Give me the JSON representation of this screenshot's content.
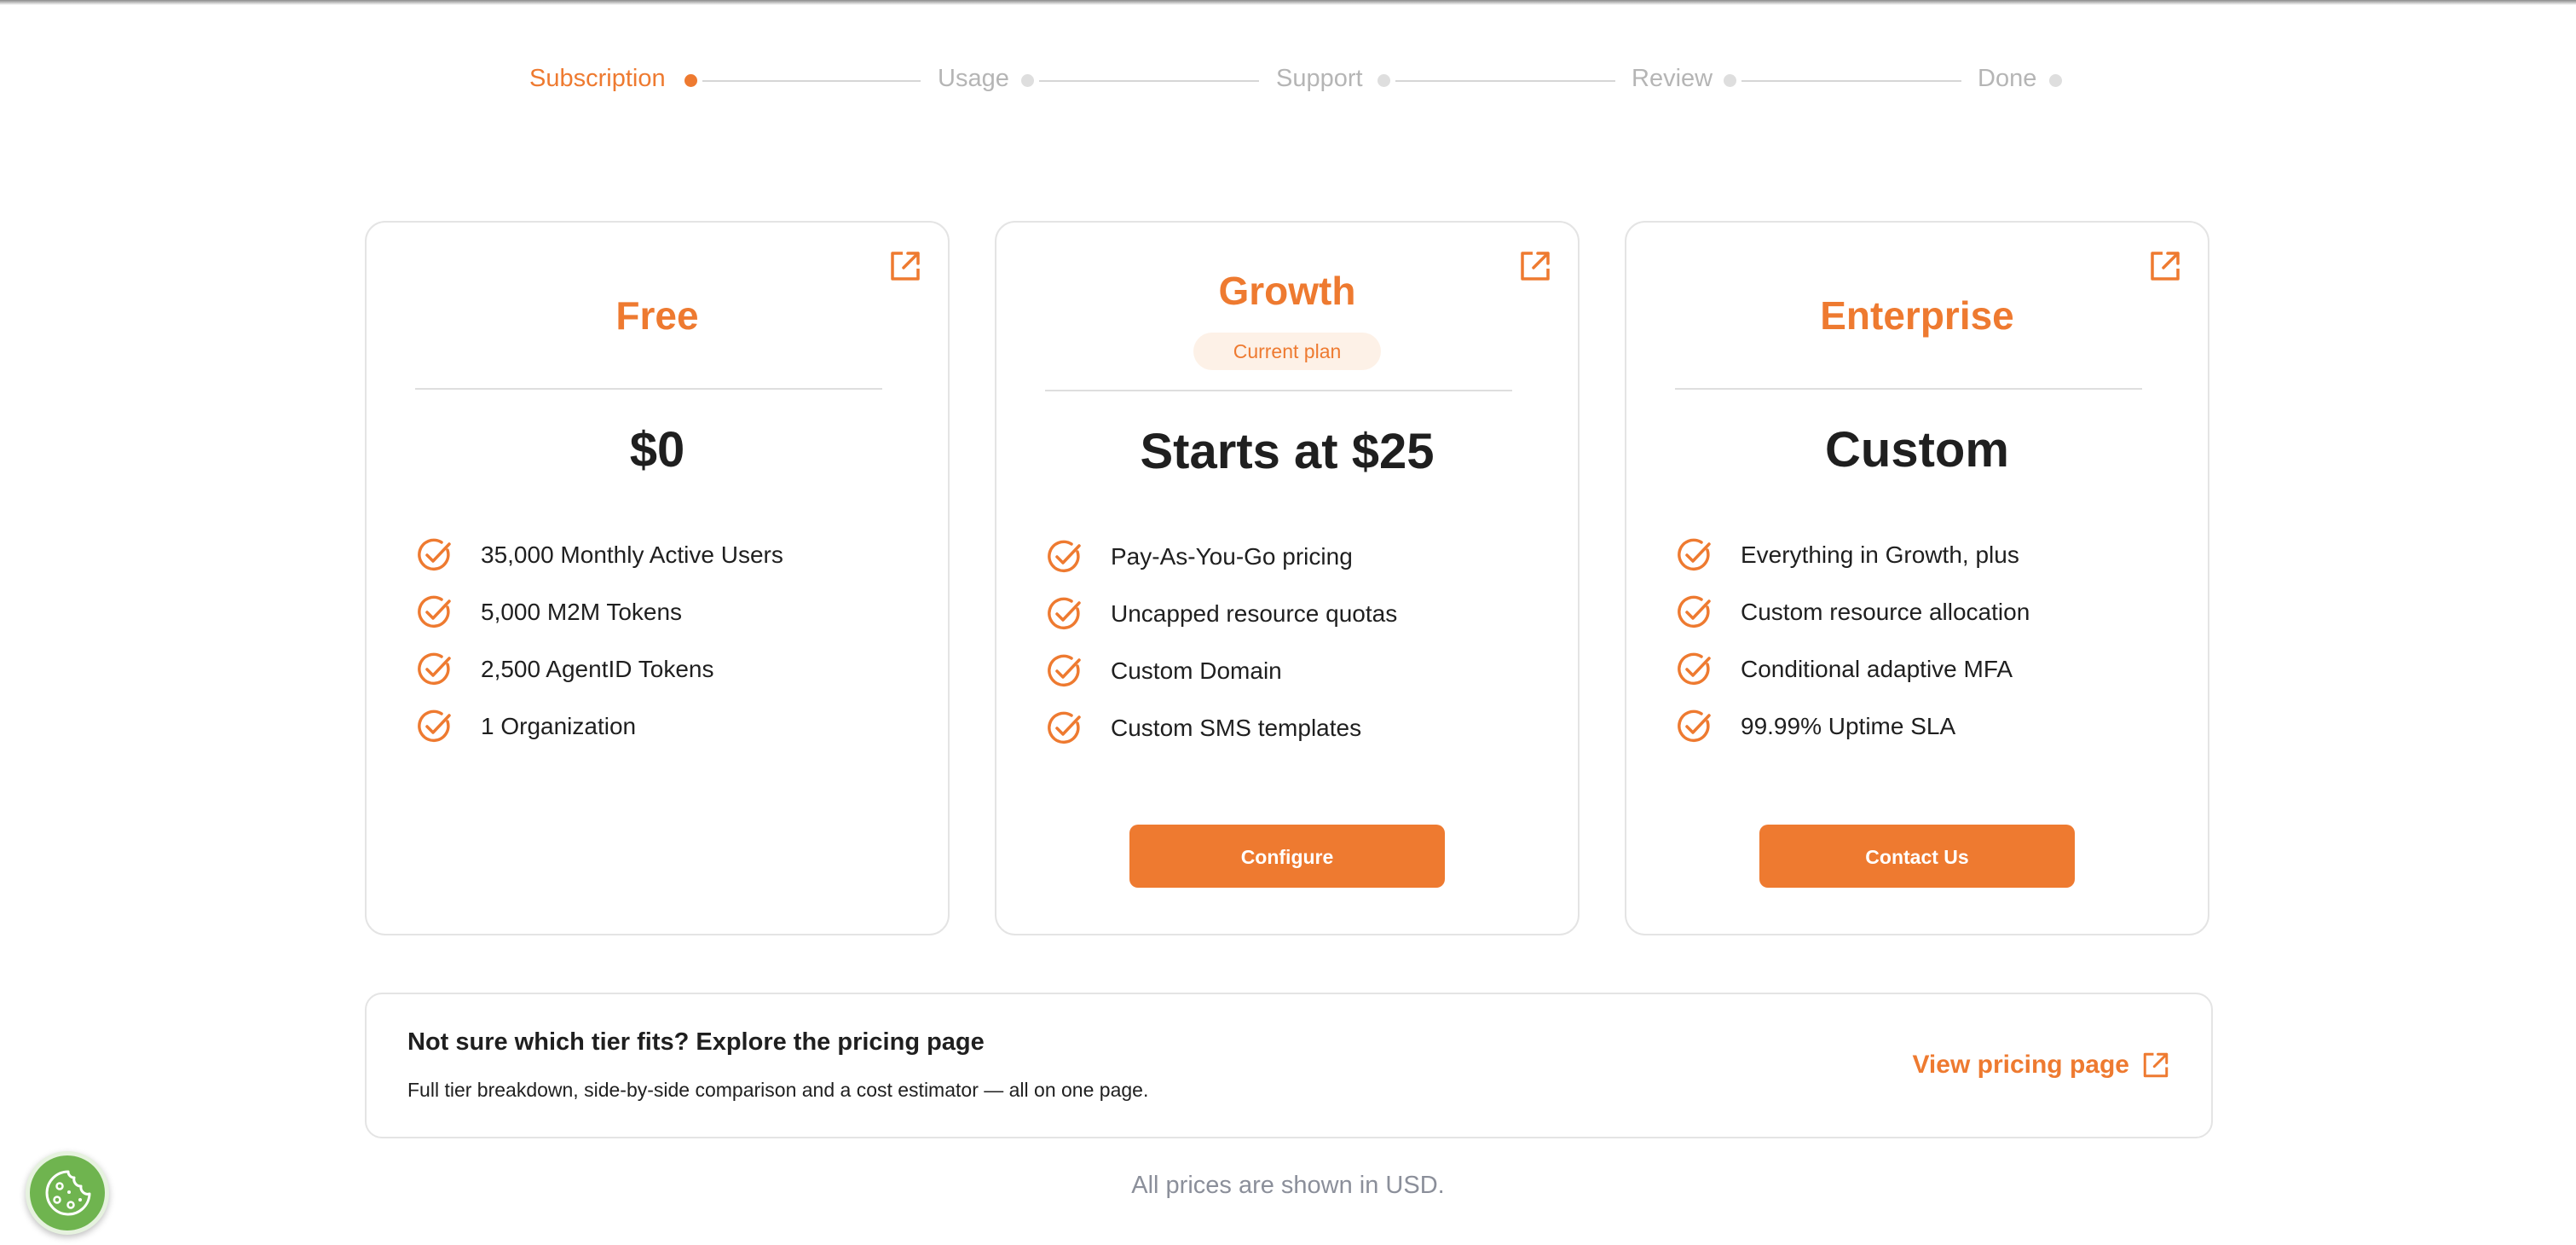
{
  "stepper": {
    "steps": [
      {
        "label": "Subscription",
        "active": true
      },
      {
        "label": "Usage",
        "active": false
      },
      {
        "label": "Support",
        "active": false
      },
      {
        "label": "Review",
        "active": false
      },
      {
        "label": "Done",
        "active": false
      }
    ]
  },
  "plans": [
    {
      "name": "Free",
      "price": "$0",
      "features": [
        "35,000 Monthly Active Users",
        "5,000 M2M Tokens",
        "2,500 AgentID Tokens",
        "1 Organization"
      ],
      "icon": "external-link-icon"
    },
    {
      "name": "Growth",
      "badge": "Current plan",
      "price": "Starts at $25",
      "features": [
        "Pay-As-You-Go pricing",
        "Uncapped resource quotas",
        "Custom Domain",
        "Custom SMS templates"
      ],
      "cta": "Configure",
      "icon": "external-link-icon"
    },
    {
      "name": "Enterprise",
      "price": "Custom",
      "features": [
        "Everything in Growth, plus",
        "Custom resource allocation",
        "Conditional adaptive MFA",
        "99.99% Uptime SLA"
      ],
      "cta": "Contact Us",
      "icon": "external-link-icon"
    }
  ],
  "explore": {
    "title": "Not sure which tier fits? Explore the pricing page",
    "subtitle": "Full tier breakdown, side-by-side comparison and a cost estimator — all on one page.",
    "link_label": "View pricing page"
  },
  "footer_note": "All prices are shown in USD.",
  "cookie_button": {
    "icon": "cookie-icon"
  },
  "colors": {
    "accent": "#ee7a30",
    "badge_bg": "#fdf1e7",
    "muted": "#b5b5b5",
    "cookie_green": "#6fb44f"
  }
}
